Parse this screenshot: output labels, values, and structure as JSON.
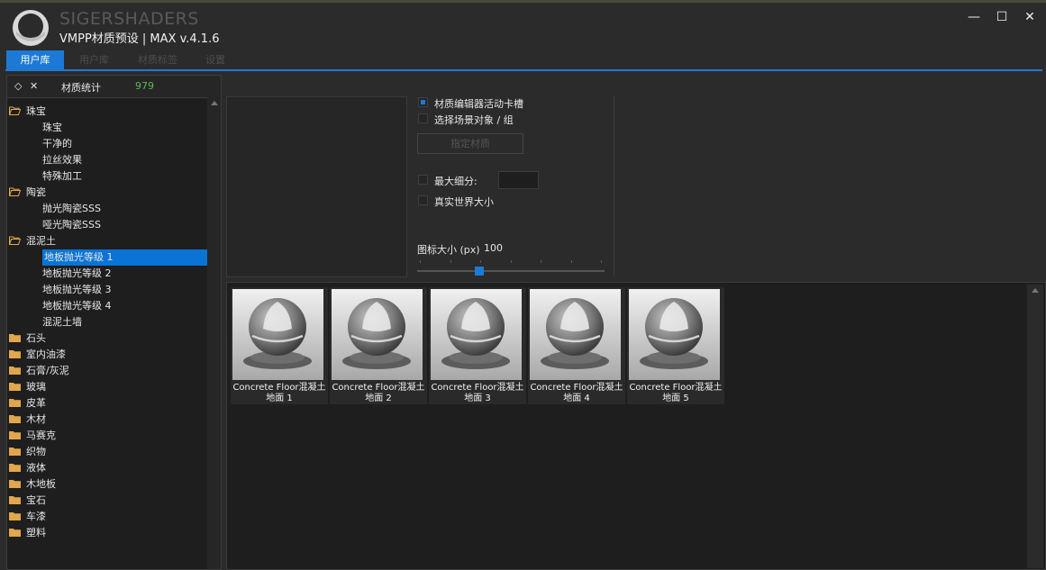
{
  "app": {
    "brand": "SIGERSHADERS",
    "version": "VMPP材质预设 | MAX v.4.1.6",
    "window_buttons": [
      "—",
      "☐",
      "✕"
    ]
  },
  "tabs": [
    {
      "label": "用户库",
      "active": true
    },
    {
      "label": "用户库",
      "active": false
    },
    {
      "label": "材质标签",
      "active": false
    },
    {
      "label": "设置",
      "active": false
    }
  ],
  "left_panel": {
    "expand_icon": "◇",
    "collapse_icon": "✕",
    "stats_label": "材质统计",
    "stats_count": "979",
    "tree": [
      {
        "label": "珠宝",
        "type": "folder",
        "open": true
      },
      {
        "label": "珠宝",
        "type": "child"
      },
      {
        "label": "干净的",
        "type": "child"
      },
      {
        "label": "拉丝效果",
        "type": "child"
      },
      {
        "label": "特殊加工",
        "type": "child"
      },
      {
        "label": "陶瓷",
        "type": "folder",
        "open": true
      },
      {
        "label": "抛光陶瓷SSS",
        "type": "child"
      },
      {
        "label": "哑光陶瓷SSS",
        "type": "child"
      },
      {
        "label": "混泥土",
        "type": "folder",
        "open": true
      },
      {
        "label": "地板抛光等级 1",
        "type": "child",
        "selected": true
      },
      {
        "label": "地板抛光等级 2",
        "type": "child"
      },
      {
        "label": "地板抛光等级 3",
        "type": "child"
      },
      {
        "label": "地板抛光等级 4",
        "type": "child"
      },
      {
        "label": "混泥土墙",
        "type": "child"
      },
      {
        "label": "石头",
        "type": "folder"
      },
      {
        "label": "室内油漆",
        "type": "folder"
      },
      {
        "label": "石膏/灰泥",
        "type": "folder"
      },
      {
        "label": "玻璃",
        "type": "folder"
      },
      {
        "label": "皮革",
        "type": "folder"
      },
      {
        "label": "木材",
        "type": "folder"
      },
      {
        "label": "马赛克",
        "type": "folder"
      },
      {
        "label": "织物",
        "type": "folder"
      },
      {
        "label": "液体",
        "type": "folder"
      },
      {
        "label": "木地板",
        "type": "folder"
      },
      {
        "label": "宝石",
        "type": "folder"
      },
      {
        "label": "车漆",
        "type": "folder"
      },
      {
        "label": "塑料",
        "type": "folder"
      }
    ]
  },
  "options": {
    "editor_slot_label": "材质编辑器活动卡槽",
    "editor_slot_checked": true,
    "select_objects_label": "选择场景对象 / 组",
    "select_objects_checked": false,
    "assign_button": "指定材质",
    "max_subdiv_label": "最大细分:",
    "max_subdiv_checked": false,
    "real_world_label": "真实世界大小",
    "real_world_checked": false,
    "icon_size_label": "图标大小 (px)",
    "icon_size_value": "100",
    "icon_size_fraction": 0.33
  },
  "gallery": [
    {
      "line1": "Concrete Floor混凝土",
      "line2": "地面 1"
    },
    {
      "line1": "Concrete Floor混凝土",
      "line2": "地面 2"
    },
    {
      "line1": "Concrete Floor混凝土",
      "line2": "地面 3"
    },
    {
      "line1": "Concrete Floor混凝土",
      "line2": "地面 4"
    },
    {
      "line1": "Concrete Floor混凝土",
      "line2": "地面 5"
    }
  ],
  "colors": {
    "accent": "#1c7ad6",
    "count_green": "#5cb85c",
    "folder": "#e0a84a"
  }
}
